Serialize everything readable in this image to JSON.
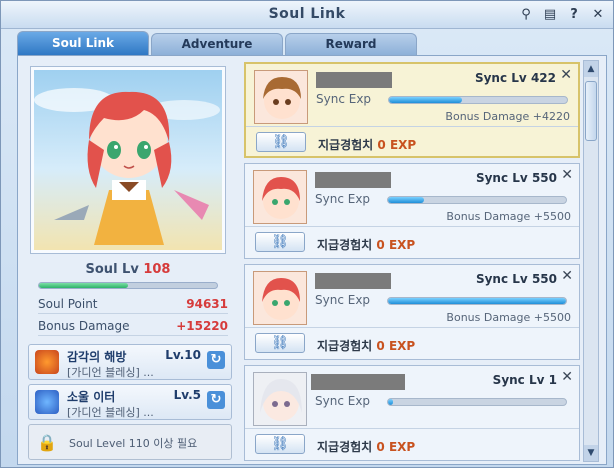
{
  "window": {
    "title": "Soul Link"
  },
  "titlebar_icons": [
    {
      "name": "search-icon",
      "glyph": "⚲"
    },
    {
      "name": "chat-icon",
      "glyph": "▤"
    },
    {
      "name": "help-icon",
      "glyph": "?"
    },
    {
      "name": "close-icon",
      "glyph": "✕"
    }
  ],
  "tabs": [
    {
      "label": "Soul Link",
      "active": true
    },
    {
      "label": "Adventure",
      "active": false
    },
    {
      "label": "Reward",
      "active": false
    }
  ],
  "soul": {
    "level_label": "Soul Lv",
    "level_value": "108",
    "level_progress": 0.5,
    "stats": [
      {
        "label": "Soul Point",
        "value": "94631"
      },
      {
        "label": "Bonus Damage",
        "value": "+15220"
      }
    ]
  },
  "skills": [
    {
      "name": "감각의 해방",
      "level": "Lv.10",
      "sub": "[가디언 블레싱] ...",
      "icon": "orange-gem-icon"
    },
    {
      "name": "소울 이터",
      "level": "Lv.5",
      "sub": "[가디언 블레싱] ...",
      "icon": "blue-m-gem-icon"
    }
  ],
  "locked_slot": {
    "text": "Soul Level 110 이상 필요"
  },
  "cards": [
    {
      "sync_label": "Sync Lv",
      "sync_lv": "422",
      "exp_label": "Sync Exp",
      "exp_progress": 0.41,
      "bonus": "Bonus Damage +4220",
      "selected": true,
      "avatar": "brown-hair-avatar",
      "bottom_prefix": "지급경험치",
      "bottom_value": "0",
      "bottom_unit": "EXP"
    },
    {
      "sync_label": "Sync Lv",
      "sync_lv": "550",
      "exp_label": "Sync Exp",
      "exp_progress": 0.2,
      "bonus": "Bonus Damage +5500",
      "selected": false,
      "avatar": "red-hair-avatar",
      "bottom_prefix": "지급경험치",
      "bottom_value": "0",
      "bottom_unit": "EXP"
    },
    {
      "sync_label": "Sync Lv",
      "sync_lv": "550",
      "exp_label": "Sync Exp",
      "exp_progress": 1.0,
      "bonus": "Bonus Damage +5500",
      "selected": false,
      "avatar": "red-hair-avatar",
      "bottom_prefix": "지급경험치",
      "bottom_value": "0",
      "bottom_unit": "EXP"
    },
    {
      "sync_label": "Sync Lv",
      "sync_lv": "1",
      "exp_label": "Sync Exp",
      "exp_progress": 0.03,
      "bonus": "",
      "selected": false,
      "avatar": "silver-hair-avatar",
      "bottom_prefix": "지급경험치",
      "bottom_value": "0",
      "bottom_unit": "EXP"
    }
  ],
  "colors": {
    "accent": "#2f78c4",
    "value_red": "#d63b3b",
    "exp_orange": "#c8521f",
    "level_bar": "#3ec47a"
  }
}
